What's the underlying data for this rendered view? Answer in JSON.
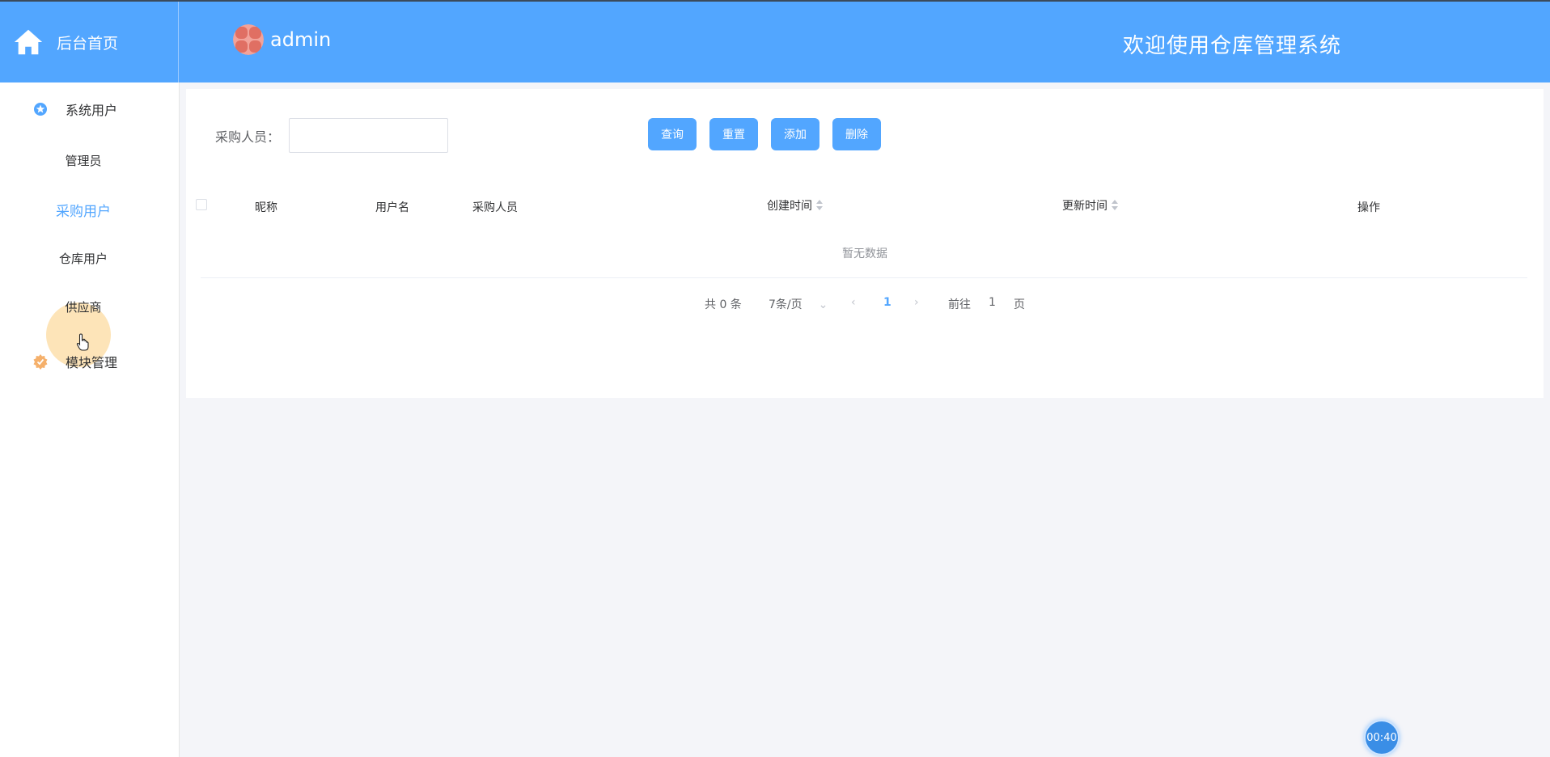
{
  "header": {
    "brand_label": "后台首页",
    "username": "admin",
    "welcome": "欢迎使用仓库管理系统"
  },
  "sidebar": {
    "groups": [
      {
        "label": "系统用户",
        "icon": "star-icon",
        "color": "#52a6ff"
      },
      {
        "label": "模块管理",
        "icon": "gear-badge-icon",
        "color": "#f5b06b"
      }
    ],
    "items": [
      {
        "label": "管理员"
      },
      {
        "label": "采购用户"
      },
      {
        "label": "仓库用户"
      },
      {
        "label": "供应商"
      }
    ],
    "active_item": "采购用户"
  },
  "search": {
    "label": "采购人员：",
    "value": "",
    "placeholder": ""
  },
  "buttons": {
    "query": "查询",
    "reset": "重置",
    "add": "添加",
    "delete": "删除"
  },
  "table": {
    "columns": [
      "昵称",
      "用户名",
      "采购人员",
      "创建时间",
      "更新时间",
      "操作"
    ],
    "rows": [],
    "empty_text": "暂无数据"
  },
  "pagination": {
    "total": "共 0 条",
    "page_size": "7条/页",
    "current_page": "1",
    "goto_prefix": "前往",
    "goto_value": "1",
    "goto_suffix": "页"
  },
  "timer": "00:40",
  "colors": {
    "accent": "#52a6ff",
    "background": "#f4f5f9"
  }
}
